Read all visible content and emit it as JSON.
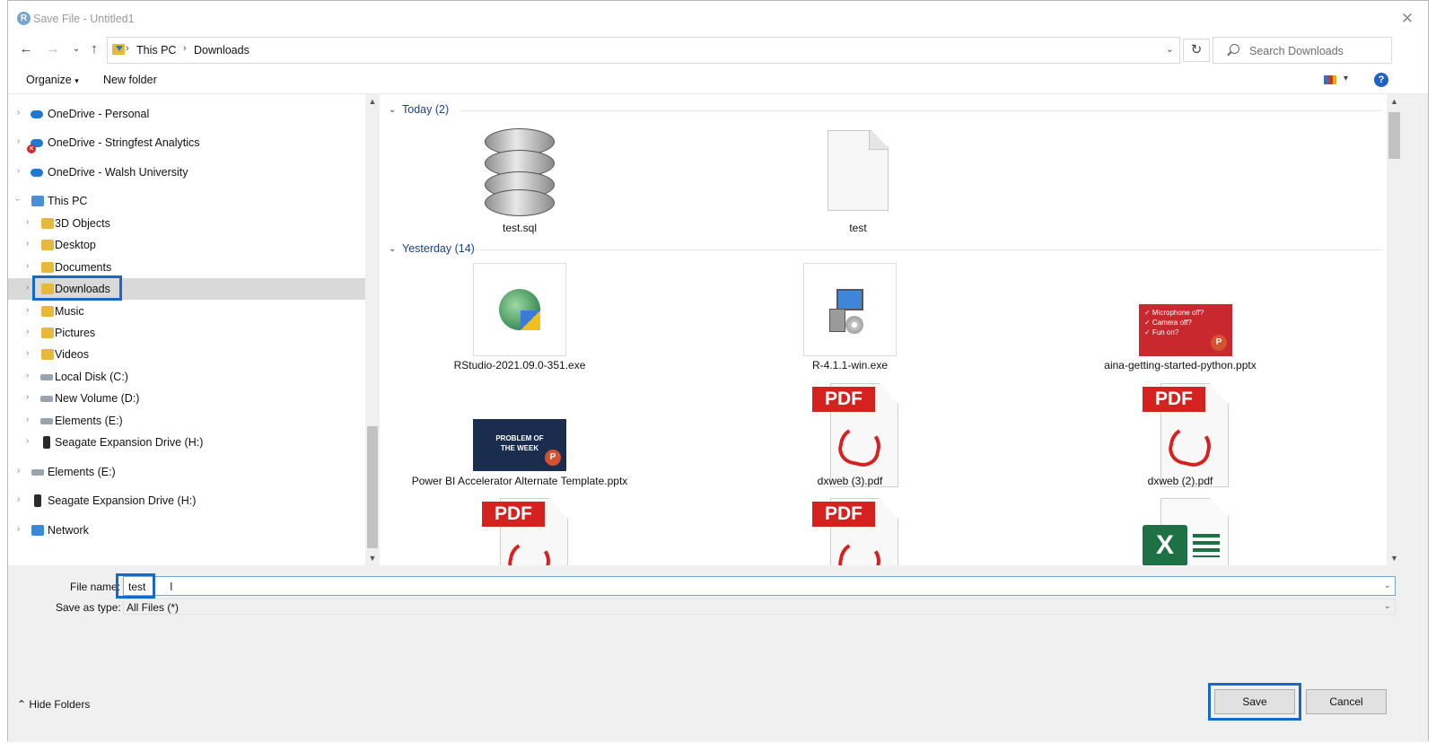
{
  "window": {
    "title": "Save File - Untitled1",
    "app_icon_letter": "R"
  },
  "address": {
    "crumbs": [
      "This PC",
      "Downloads"
    ],
    "search_placeholder": "Search Downloads"
  },
  "toolbar": {
    "organize": "Organize",
    "new_folder": "New folder"
  },
  "nav": {
    "items": [
      {
        "label": "OneDrive - Personal",
        "icon": "onedrive-icon"
      },
      {
        "label": "OneDrive - Stringfest Analytics",
        "icon": "onedrive-icon",
        "error": true
      },
      {
        "label": "OneDrive - Walsh University",
        "icon": "onedrive-icon"
      },
      {
        "label": "This PC",
        "icon": "computer-icon",
        "expanded": true
      },
      {
        "label": "3D Objects",
        "icon": "folder-3d-icon"
      },
      {
        "label": "Desktop",
        "icon": "folder-desktop-icon"
      },
      {
        "label": "Documents",
        "icon": "folder-documents-icon"
      },
      {
        "label": "Downloads",
        "icon": "folder-downloads-icon",
        "selected": true
      },
      {
        "label": "Music",
        "icon": "folder-music-icon"
      },
      {
        "label": "Pictures",
        "icon": "folder-pictures-icon"
      },
      {
        "label": "Videos",
        "icon": "folder-videos-icon"
      },
      {
        "label": "Local Disk (C:)",
        "icon": "disk-icon"
      },
      {
        "label": "New Volume (D:)",
        "icon": "disk-icon"
      },
      {
        "label": "Elements (E:)",
        "icon": "disk-icon"
      },
      {
        "label": "Seagate Expansion Drive (H:)",
        "icon": "external-drive-icon"
      },
      {
        "label": "Elements (E:)",
        "icon": "disk-icon"
      },
      {
        "label": "Seagate Expansion Drive (H:)",
        "icon": "external-drive-icon"
      },
      {
        "label": "Network",
        "icon": "network-icon"
      }
    ]
  },
  "groups": {
    "today": "Today (2)",
    "yesterday": "Yesterday (14)"
  },
  "files": {
    "today": [
      "test.sql",
      "test"
    ],
    "yesterday": [
      "RStudio-2021.09.0-351.exe",
      "R-4.1.1-win.exe",
      "aina-getting-started-python.pptx",
      "Power BI Accelerator Alternate Template.pptx",
      "dxweb (3).pdf",
      "dxweb (2).pdf"
    ]
  },
  "thumbs": {
    "pdf_text": "PDF",
    "excel_letter": "X",
    "ppt_letter": "P",
    "aina_lines": [
      "✓ Microphone off?",
      "✓ Camera off?",
      "✓ Fun on?"
    ],
    "powerbi_lines": [
      "PROBLEM OF",
      "THE WEEK"
    ]
  },
  "form": {
    "file_name_label": "File name:",
    "file_name_value": "test",
    "save_type_label": "Save as type:",
    "save_type_value": "All Files  (*)",
    "hide_folders": "Hide Folders",
    "save": "Save",
    "cancel": "Cancel"
  },
  "colors": {
    "highlight": "#1569c7",
    "group_header": "#1b3f8a",
    "pdf_red": "#d6221e",
    "excel_green": "#1e7145"
  }
}
